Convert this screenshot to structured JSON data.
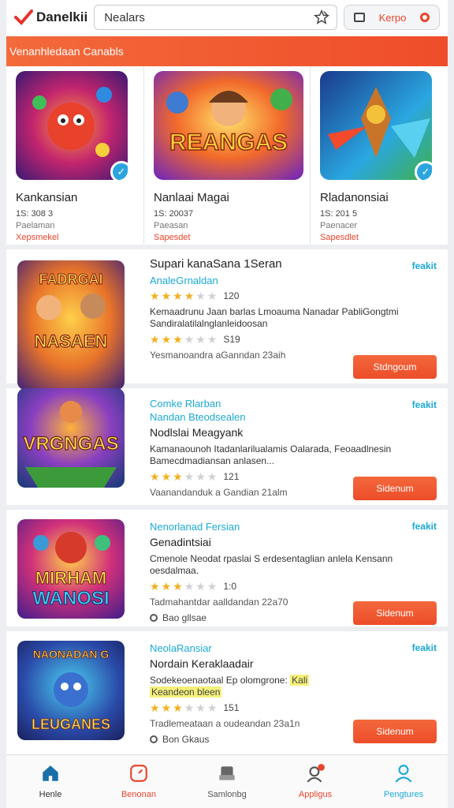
{
  "header": {
    "app_name": "Danelkii",
    "search_text": "Nealars",
    "pill_label": "Kerpo"
  },
  "banner": {
    "text": "Venanhledaan Canabls"
  },
  "featured": [
    {
      "title": "Kankansian",
      "meta": "1S: 308 3",
      "sub": "Paelaman",
      "red": "Xepsmekel",
      "colors": [
        "#b3266b",
        "#f07a2a"
      ]
    },
    {
      "title": "Nanlaai Magai",
      "meta": "1S: 20037",
      "sub": "Paeasan",
      "red": "Sapesdet",
      "colors": [
        "#f2582a",
        "#ffd04a"
      ],
      "art_text": "REANGAS"
    },
    {
      "title": "Rladanonsiai",
      "meta": "1S: 201 5",
      "sub": "Paenacer",
      "red": "Sapesdlet",
      "colors": [
        "#1a7ec2",
        "#5bd0f4"
      ]
    }
  ],
  "list": [
    {
      "title": "Supari kanaSana 1Seran",
      "tag": "feakit",
      "cyan": "AnaleGrnaldan",
      "rating_stars": 3.5,
      "rating_count": "120",
      "desc": "Kemaadrunu Jaan barlas Lmoauma Nanadar PabliGongtmi Sandiralatilalnglanleidoosan",
      "rating2_stars": 3,
      "rating2_count": "S19",
      "foot": "Yesmanoandra aGanndan 23aih",
      "button": "Stdngoum",
      "art_text": "FADRGAI NASAEN",
      "colors": [
        "#e8732a",
        "#c1273a"
      ]
    },
    {
      "title": "Nodlslai Meagyank",
      "tag": "feakit",
      "cyan": "Comke Rlarban",
      "cyan2": "Nandan Bteodsealen",
      "desc": "Kamanaounoh Itadanlarilualamis Oalarada, Feoaadlnesin Bamecdmadiansan anlasen...",
      "rating_stars": 3,
      "rating_count": "121",
      "foot": "Vaanandanduk a Gandian 21alm",
      "button": "Sidenum",
      "art_text": "VRGNGAS",
      "colors": [
        "#6b2fa6",
        "#2a9ad6"
      ]
    },
    {
      "title": "Genadintsiai",
      "tag": "feakit",
      "cyan": "Nenorlanad Fersian",
      "desc": "Cmenole Neodat rpaslai S erdesentaglian anlela Kensann oesdalmaa.",
      "rating_stars": 3,
      "rating_count": "1:0",
      "foot": "Tadmahantdar aalldandan 22a70",
      "location": "Bao gllsae",
      "button": "Sidenum",
      "art_text": "MIRHAM WANOSI",
      "colors": [
        "#c5246a",
        "#f2a52a"
      ]
    },
    {
      "title": "Nordain Keraklaadair",
      "tag": "feakit",
      "cyan": "NeolaRansiar",
      "desc": "Sodekeoenaotaal Ep olomgrone: ",
      "desc_hl": "Kali",
      "desc2_hl": "Keandeon bleen",
      "rating_stars": 3,
      "rating_count": "151",
      "foot": "Tradlemeataan a oudeandan 23a1n",
      "location": "Bon Gkaus",
      "button": "Sidenum",
      "art_text": "NAONADAN G LEUGANES",
      "colors": [
        "#1f3f9c",
        "#3ac0e6"
      ]
    }
  ],
  "nav": [
    {
      "label": "Henle",
      "icon": "home-icon",
      "color": "#1a6fa8"
    },
    {
      "label": "Benonan",
      "icon": "gauge-icon",
      "color": "#e9452c"
    },
    {
      "label": "Samlonbg",
      "icon": "tray-icon",
      "color": "#555555"
    },
    {
      "label": "Appligus",
      "icon": "user-badge-icon",
      "color": "#e9452c"
    },
    {
      "label": "Pengtures",
      "icon": "person-icon",
      "color": "#1ba9d6"
    }
  ],
  "colors": {
    "accent": "#ef4d2a",
    "link": "#1ba9d6",
    "star": "#f2b01e"
  }
}
